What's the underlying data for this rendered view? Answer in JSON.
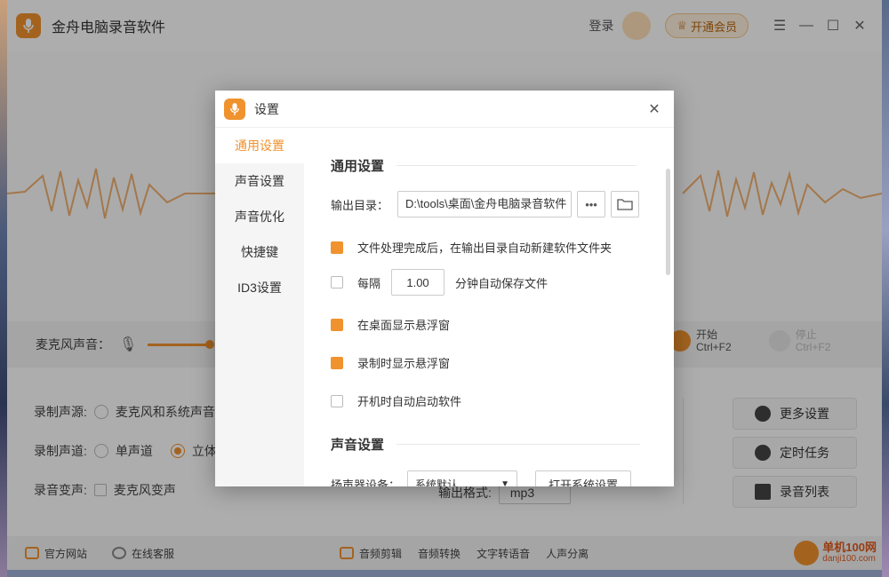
{
  "app": {
    "title": "金舟电脑录音软件",
    "login": "登录",
    "vip": "开通会员",
    "mic_label": "麦克风声音：",
    "start_label": "开始",
    "start_hotkey": "Ctrl+F2",
    "stop_label": "停止",
    "stop_hotkey": "Ctrl+F2"
  },
  "options": {
    "source_label": "录制声源:",
    "source_value": "麦克风和系统声音",
    "channel_label": "录制声道:",
    "channel_mono": "单声道",
    "channel_stereo": "立体声",
    "voice_label": "录音变声:",
    "voice_value": "麦克风变声",
    "format_label": "输出格式:",
    "format_value": "mp3"
  },
  "side_buttons": [
    "更多设置",
    "定时任务",
    "录音列表"
  ],
  "footer": {
    "website": "官方网站",
    "service": "在线客服",
    "tools": [
      "音频剪辑",
      "音频转换",
      "文字转语音",
      "人声分离"
    ],
    "watermark": "单机100网",
    "watermark_url": "danji100.com"
  },
  "dialog": {
    "title": "设置",
    "nav": [
      "通用设置",
      "声音设置",
      "声音优化",
      "快捷键",
      "ID3设置"
    ],
    "section_general": "通用设置",
    "output_label": "输出目录：",
    "output_path": "D:\\tools\\桌面\\金舟电脑录音软件",
    "opt1": "文件处理完成后，在输出目录自动新建软件文件夹",
    "opt2_prefix": "每隔",
    "opt2_value": "1.00",
    "opt2_suffix": "分钟自动保存文件",
    "opt3": "在桌面显示悬浮窗",
    "opt4": "录制时显示悬浮窗",
    "opt5": "开机时自动启动软件",
    "section_sound": "声音设置",
    "speaker_label": "扬声器设备：",
    "speaker_value": "系统默认",
    "open_settings": "打开系统设置",
    "checked": [
      true,
      false,
      true,
      true,
      false
    ]
  },
  "colors": {
    "accent": "#f0922e"
  }
}
